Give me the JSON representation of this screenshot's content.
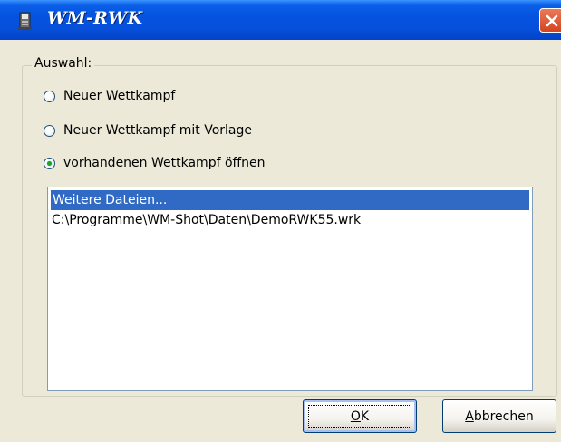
{
  "window": {
    "title": "WM-RWK",
    "icons": {
      "app": "app-icon",
      "close": "close-icon"
    }
  },
  "group": {
    "label": "Auswahl:",
    "options": [
      {
        "label": "Neuer Wettkampf",
        "checked": false
      },
      {
        "label": "Neuer Wettkampf mit Vorlage",
        "checked": false
      },
      {
        "label": "vorhandenen Wettkampf öffnen",
        "checked": true
      }
    ]
  },
  "list": {
    "items": [
      {
        "text": "Weitere Dateien...",
        "selected": true
      },
      {
        "text": "C:\\Programme\\WM-Shot\\Daten\\DemoRWK55.wrk",
        "selected": false
      }
    ]
  },
  "buttons": {
    "ok": {
      "label": "OK",
      "accel": "O",
      "rest": "K"
    },
    "cancel": {
      "label": "Abbrechen",
      "accel": "A",
      "rest": "bbrechen"
    }
  },
  "colors": {
    "titlebar": "#0553E0",
    "selection": "#316AC5",
    "face": "#ECE9D8"
  }
}
